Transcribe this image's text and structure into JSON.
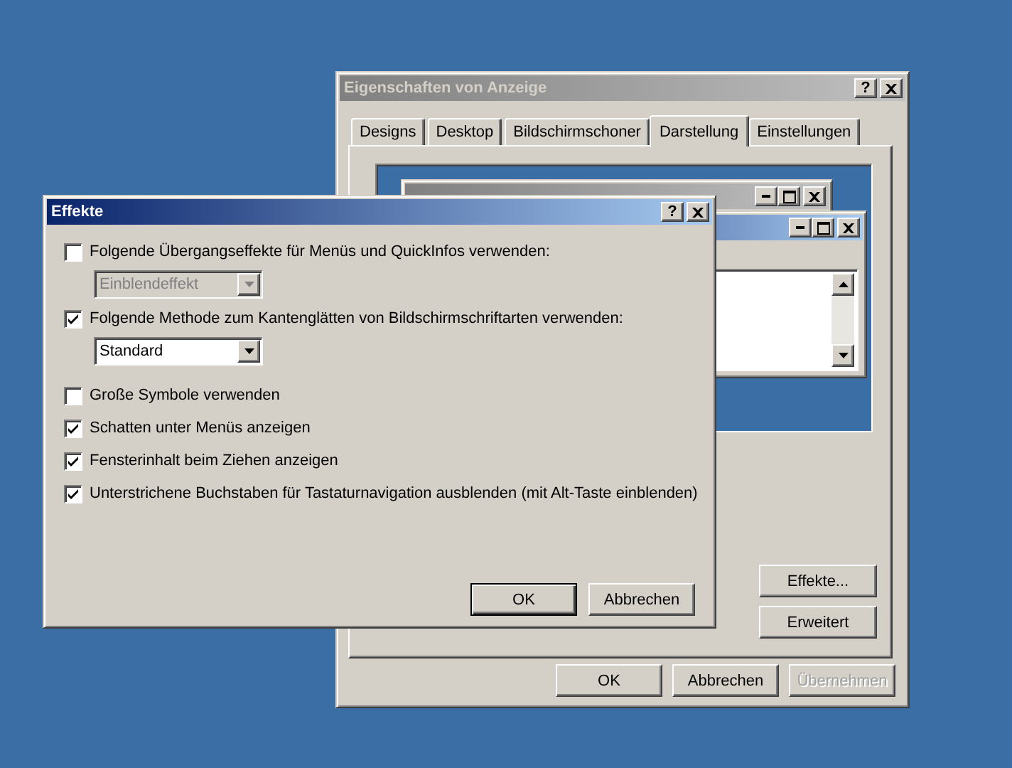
{
  "properties_window": {
    "title": "Eigenschaften von Anzeige",
    "active": false,
    "help": "?",
    "tabs": [
      {
        "label": "Designs",
        "selected": false
      },
      {
        "label": "Desktop",
        "selected": false
      },
      {
        "label": "Bildschirmschoner",
        "selected": false
      },
      {
        "label": "Darstellung",
        "selected": true
      },
      {
        "label": "Einstellungen",
        "selected": false
      }
    ],
    "preview": {
      "inactive_window": {
        "active": false
      },
      "active_window": {
        "active": true
      }
    },
    "side_buttons": [
      "Effekte...",
      "Erweitert"
    ],
    "buttons": [
      {
        "label": "OK",
        "disabled": false
      },
      {
        "label": "Abbrechen",
        "disabled": false
      },
      {
        "label": "Übernehmen",
        "disabled": true
      }
    ]
  },
  "effects_dialog": {
    "title": "Effekte",
    "active": true,
    "help": "?",
    "options": [
      {
        "kind": "checkbox",
        "label": "Folgende Übergangseffekte für Menüs und QuickInfos verwenden:",
        "checked": false
      },
      {
        "kind": "dropdown",
        "value": "Einblendeffekt",
        "disabled": true
      },
      {
        "kind": "checkbox",
        "label": "Folgende Methode zum Kantenglätten von Bildschirmschriftarten verwenden:",
        "checked": true
      },
      {
        "kind": "dropdown",
        "value": "Standard",
        "disabled": false
      },
      {
        "kind": "checkbox",
        "label": "Große Symbole verwenden",
        "checked": false
      },
      {
        "kind": "checkbox",
        "label": "Schatten unter Menüs anzeigen",
        "checked": true
      },
      {
        "kind": "checkbox",
        "label": "Fensterinhalt beim Ziehen anzeigen",
        "checked": true
      },
      {
        "kind": "checkbox",
        "label": "Unterstrichene Buchstaben für Tastaturnavigation ausblenden (mit Alt-Taste einblenden)",
        "checked": true
      }
    ],
    "buttons": [
      {
        "label": "OK",
        "default": true
      },
      {
        "label": "Abbrechen",
        "default": false
      }
    ]
  }
}
